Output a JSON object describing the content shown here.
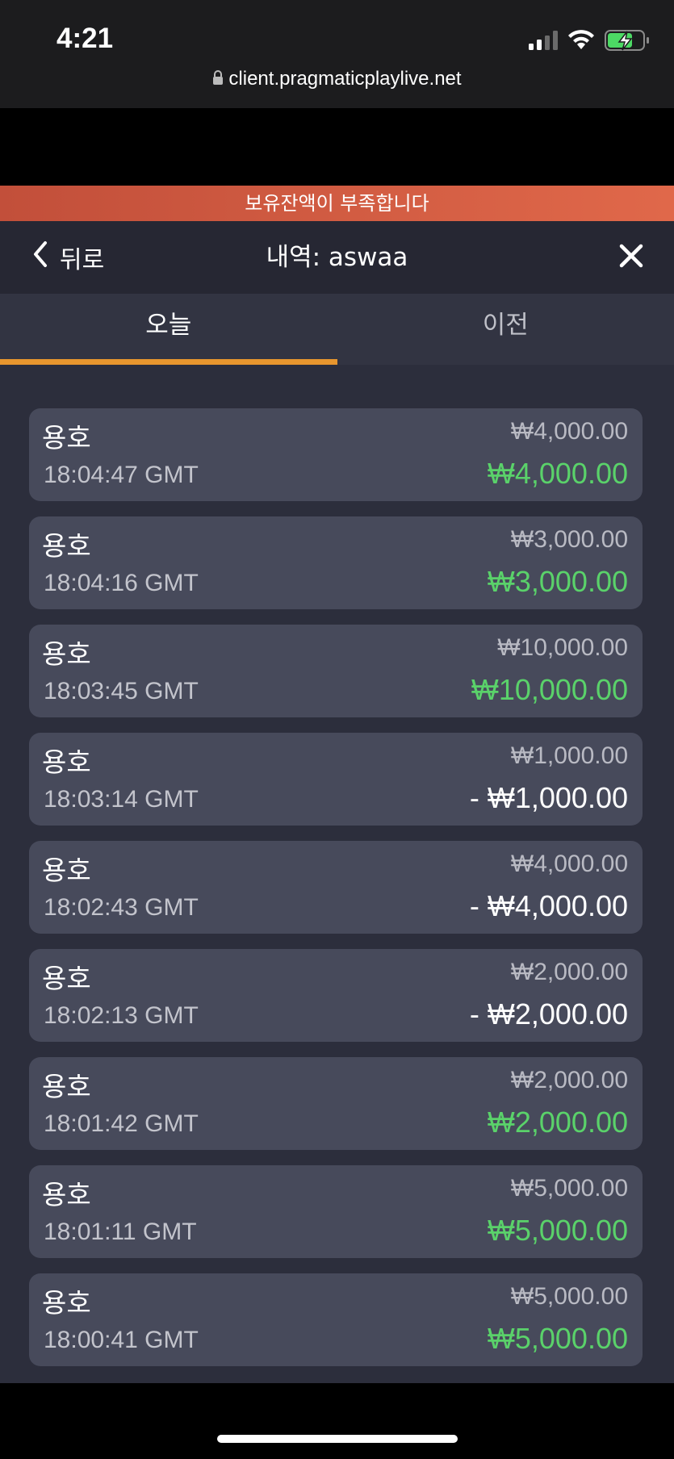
{
  "status_bar": {
    "time": "4:21",
    "icons": [
      "signal-icon",
      "wifi-icon",
      "battery-charging-icon"
    ],
    "url": "client.pragmaticplaylive.net"
  },
  "banner": {
    "text": "보유잔액이 부족합니다"
  },
  "header": {
    "back_label": "뒤로",
    "title": "내역: aswaa"
  },
  "tabs": [
    {
      "label": "오늘",
      "active": true
    },
    {
      "label": "이전",
      "active": false
    }
  ],
  "history": [
    {
      "game": "용호",
      "time": "18:04:47 GMT",
      "bet": "₩4,000.00",
      "result": "₩4,000.00",
      "outcome": "win"
    },
    {
      "game": "용호",
      "time": "18:04:16 GMT",
      "bet": "₩3,000.00",
      "result": "₩3,000.00",
      "outcome": "win"
    },
    {
      "game": "용호",
      "time": "18:03:45 GMT",
      "bet": "₩10,000.00",
      "result": "₩10,000.00",
      "outcome": "win"
    },
    {
      "game": "용호",
      "time": "18:03:14 GMT",
      "bet": "₩1,000.00",
      "result": "- ₩1,000.00",
      "outcome": "loss"
    },
    {
      "game": "용호",
      "time": "18:02:43 GMT",
      "bet": "₩4,000.00",
      "result": "- ₩4,000.00",
      "outcome": "loss"
    },
    {
      "game": "용호",
      "time": "18:02:13 GMT",
      "bet": "₩2,000.00",
      "result": "- ₩2,000.00",
      "outcome": "loss"
    },
    {
      "game": "용호",
      "time": "18:01:42 GMT",
      "bet": "₩2,000.00",
      "result": "₩2,000.00",
      "outcome": "win"
    },
    {
      "game": "용호",
      "time": "18:01:11 GMT",
      "bet": "₩5,000.00",
      "result": "₩5,000.00",
      "outcome": "win"
    },
    {
      "game": "용호",
      "time": "18:00:41 GMT",
      "bet": "₩5,000.00",
      "result": "₩5,000.00",
      "outcome": "win"
    }
  ],
  "colors": {
    "win": "#5ad26a",
    "loss": "#ffffff",
    "accent": "#e8962e",
    "banner": "#d85c43"
  }
}
